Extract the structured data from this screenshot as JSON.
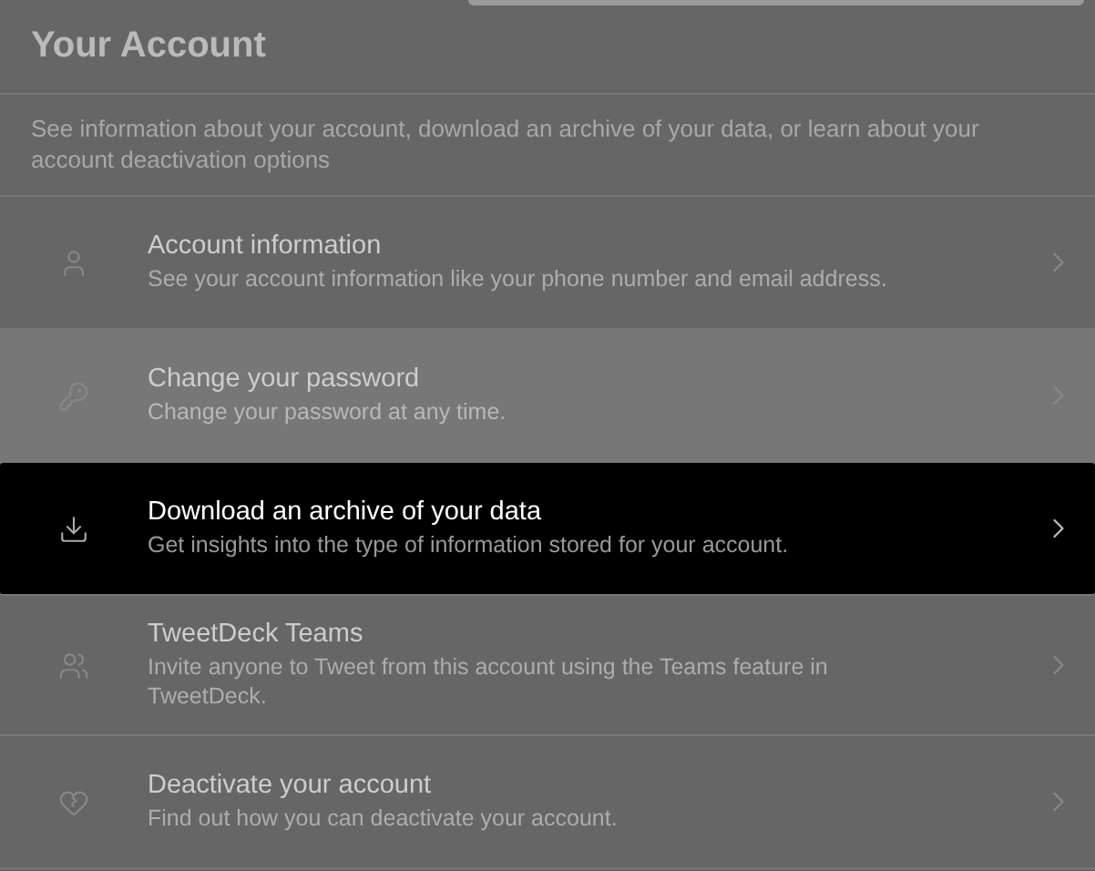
{
  "header": {
    "title": "Your Account",
    "description": "See information about your account, download an archive of your data, or learn about your account deactivation options"
  },
  "items": [
    {
      "title": "Account information",
      "subtitle": "See your account information like your phone number and email address.",
      "selected": false,
      "hovered": false
    },
    {
      "title": "Change your password",
      "subtitle": "Change your password at any time.",
      "selected": false,
      "hovered": true
    },
    {
      "title": "Download an archive of your data",
      "subtitle": "Get insights into the type of information stored for your account.",
      "selected": true,
      "hovered": false
    },
    {
      "title": "TweetDeck Teams",
      "subtitle": "Invite anyone to Tweet from this account using the Teams feature in TweetDeck.",
      "selected": false,
      "hovered": false
    },
    {
      "title": "Deactivate your account",
      "subtitle": "Find out how you can deactivate your account.",
      "selected": false,
      "hovered": false
    }
  ]
}
